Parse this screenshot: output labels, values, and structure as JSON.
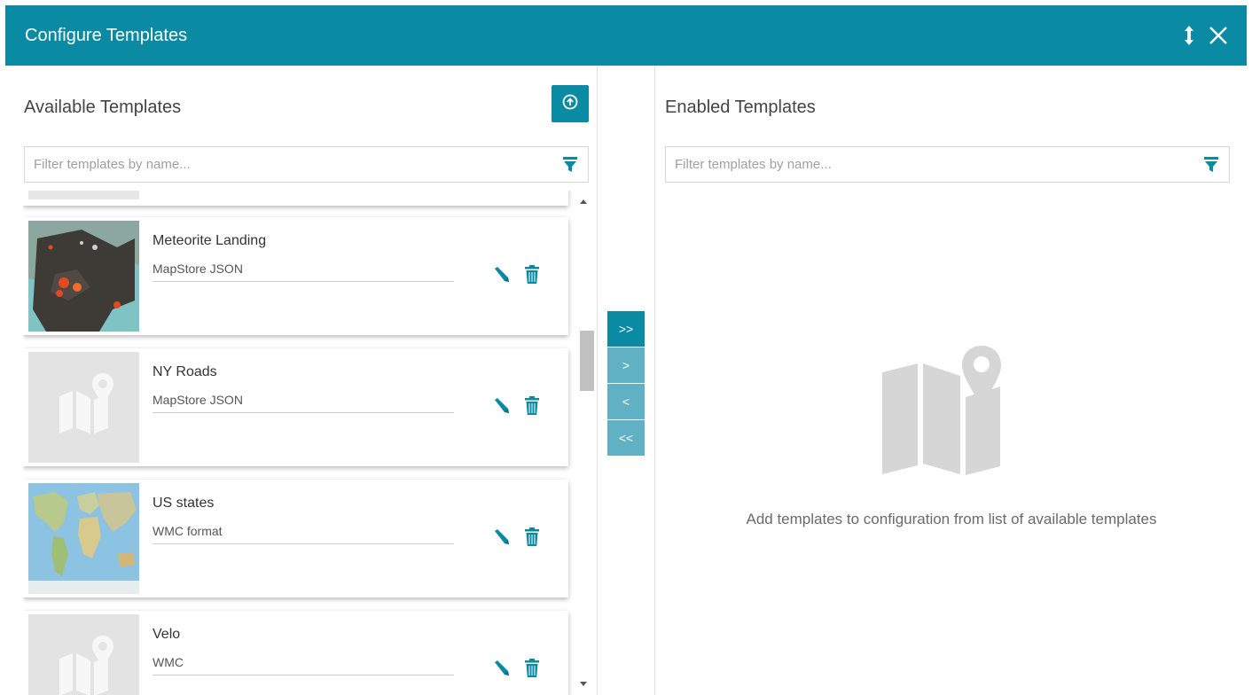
{
  "header": {
    "title": "Configure Templates",
    "resize_icon": "resize-vertical-icon",
    "close_icon": "close-icon",
    "bg_color": "#0a8aa3"
  },
  "available": {
    "title": "Available Templates",
    "upload_icon": "upload-icon",
    "filter_placeholder": "Filter templates by name...",
    "templates": [
      {
        "name": "Meteorite Landing",
        "format": "MapStore JSON",
        "thumbnail": "map-image"
      },
      {
        "name": "NY Roads",
        "format": "MapStore JSON",
        "thumbnail": "map-placeholder-icon"
      },
      {
        "name": "US states",
        "format": "WMC format",
        "thumbnail": "world-map-image"
      },
      {
        "name": "Velo",
        "format": "WMC",
        "thumbnail": "map-placeholder-icon"
      }
    ]
  },
  "transfer": {
    "move_all_right": ">>",
    "move_right": ">",
    "move_left": "<",
    "move_all_left": "<<"
  },
  "enabled": {
    "title": "Enabled Templates",
    "filter_placeholder": "Filter templates by name...",
    "empty_message": "Add templates to configuration from list of available templates"
  }
}
